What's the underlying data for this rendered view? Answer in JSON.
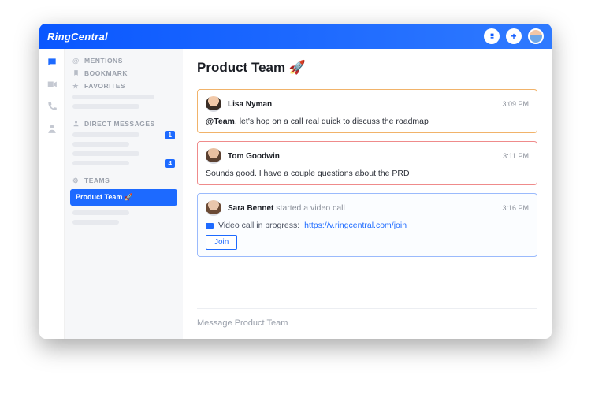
{
  "brand": "RingCentral",
  "topbar": {
    "dialpad_icon": "⋮⋮⋮",
    "plus_label": "+"
  },
  "rail": {
    "items": [
      "chat",
      "video",
      "phone",
      "contacts"
    ]
  },
  "sidebar": {
    "mentions_label": "MENTIONS",
    "bookmark_label": "BOOKMARK",
    "favorites_label": "FAVORITES",
    "dm_label": "DIRECT MESSAGES",
    "dm_badges": {
      "b1": "1",
      "b2": "4"
    },
    "teams_label": "TEAMS",
    "active_team": "Product Team 🚀"
  },
  "channel": {
    "title": "Product Team 🚀"
  },
  "messages": [
    {
      "author": "Lisa Nyman",
      "time": "3:09 PM",
      "mention": "@Team",
      "body_after_mention": ", let's hop on a call real quick to discuss the roadmap"
    },
    {
      "author": "Tom Goodwin",
      "time": "3:11 PM",
      "body": "Sounds good. I have a couple questions about the PRD"
    },
    {
      "author": "Sara Bennet",
      "author_suffix": " started a video call",
      "time": "3:16 PM",
      "video_text": "Video call in progress: ",
      "video_link": "https://v.ringcentral.com/join",
      "join_label": "Join"
    }
  ],
  "composer": {
    "placeholder": "Message Product Team"
  }
}
